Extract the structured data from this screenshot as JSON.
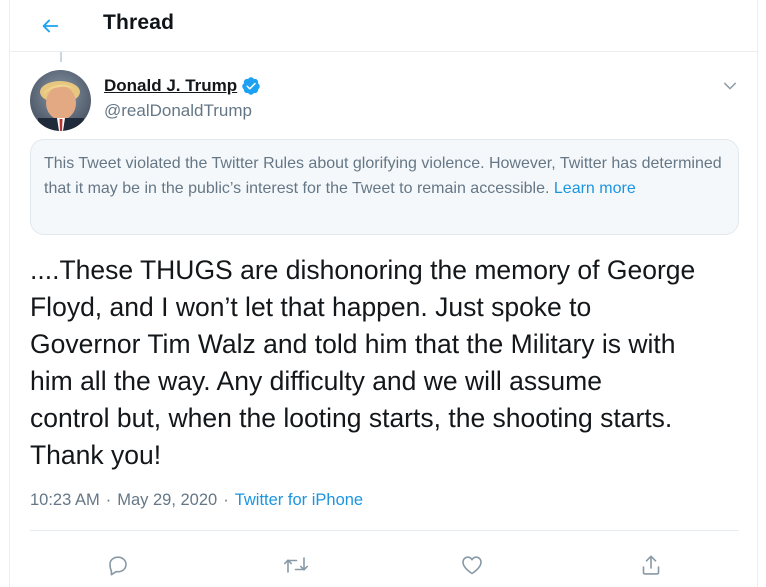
{
  "header": {
    "title": "Thread",
    "back_icon": "arrow-left-icon"
  },
  "tweet": {
    "author_name": "Donald J. Trump",
    "author_handle": "@realDonaldTrump",
    "verified_icon": "verified-badge-icon",
    "notice_text": "This Tweet violated the Twitter Rules about glorifying violence. However, Twitter has determined that it may be in the public’s interest for the Tweet to remain accessible.",
    "notice_link": "Learn more",
    "text": "....These THUGS are dishonoring the memory of George\nFloyd, and I won’t let that happen. Just spoke to\nGovernor Tim Walz and told him that the Military is with\nhim all the way. Any difficulty and we will assume\ncontrol but, when the looting starts, the shooting starts.\nThank you!",
    "time": "10:23 AM",
    "separator": "·",
    "date": "May 29, 2020",
    "source": "Twitter for iPhone"
  },
  "actions": [
    {
      "icon": "reply-icon"
    },
    {
      "icon": "retweet-icon"
    },
    {
      "icon": "like-icon"
    },
    {
      "icon": "share-icon"
    }
  ],
  "colors": {
    "accent": "#1da1f2",
    "link": "#1b95e0",
    "secondary_text": "#657786",
    "notice_background": "#f5f8fa"
  }
}
